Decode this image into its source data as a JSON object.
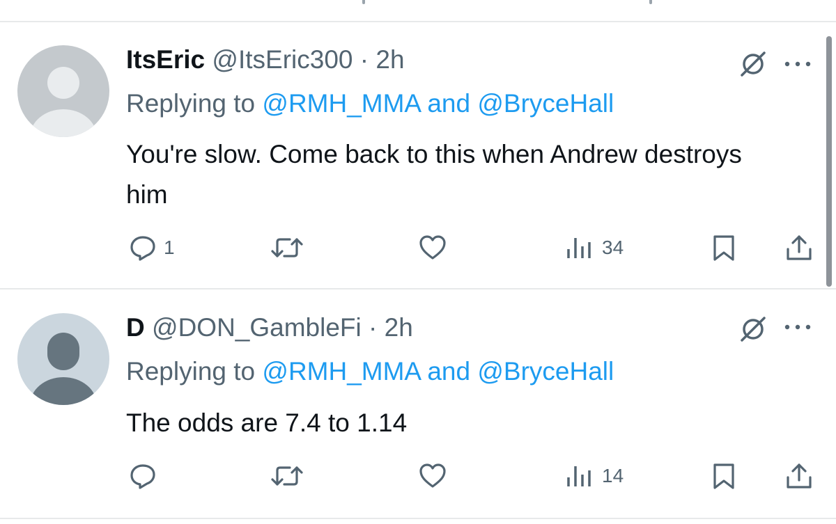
{
  "tweets": [
    {
      "display_name": "ItsEric",
      "handle": "@ItsEric300",
      "time": "· 2h",
      "replying_prefix": "Replying to",
      "replying_to": "@RMH_MMA and @BryceHall",
      "text": "You're slow. Come back to this when Andrew destroys him",
      "reply_count": "1",
      "views": "34"
    },
    {
      "display_name": "D",
      "handle": "@DON_GambleFi",
      "time": "· 2h",
      "replying_prefix": "Replying to",
      "replying_to": "@RMH_MMA and @BryceHall",
      "text": "The odds are 7.4 to 1.14",
      "reply_count": "",
      "views": "14"
    }
  ],
  "icons": {
    "reply": "reply-icon",
    "retweet": "retweet-icon",
    "like": "heart-icon",
    "views": "views-icon",
    "bookmark": "bookmark-icon",
    "share": "share-icon",
    "grok": "grok-icon",
    "more": "more-icon"
  },
  "colors": {
    "link": "#1d9bf0",
    "secondary_text": "#536471",
    "primary_text": "#0f1419",
    "divider": "#e7e9ea"
  }
}
